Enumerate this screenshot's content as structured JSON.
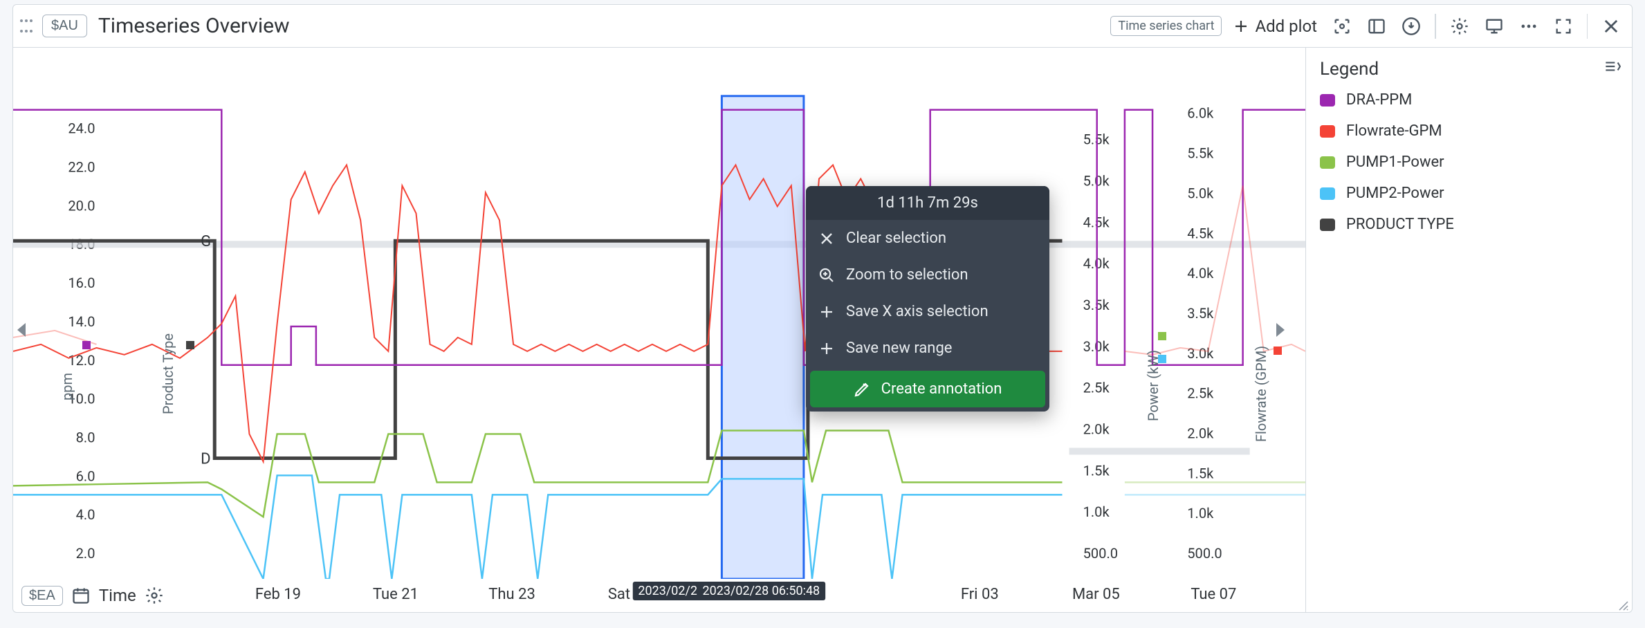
{
  "header": {
    "var_btn": "$AU",
    "title": "Timeseries Overview",
    "chart_type_chip": "Time series chart",
    "add_plot_label": "Add plot"
  },
  "legend": {
    "title": "Legend",
    "items": [
      {
        "label": "DRA-PPM",
        "color": "#9c27b0"
      },
      {
        "label": "Flowrate-GPM",
        "color": "#f44336"
      },
      {
        "label": "PUMP1-Power",
        "color": "#8bc34a"
      },
      {
        "label": "PUMP2-Power",
        "color": "#4cc3f7"
      },
      {
        "label": "PRODUCT TYPE",
        "color": "#424242"
      }
    ]
  },
  "x_axis": {
    "var_btn": "$EA",
    "time_label": "Time",
    "ticks": [
      "Feb 19",
      "Tue 21",
      "Thu 23",
      "Sat 25",
      "Fri 03",
      "Mar 05",
      "Tue 07"
    ],
    "tick_positions_pct": [
      20.5,
      29.6,
      38.6,
      47.7,
      74.8,
      83.8,
      92.9
    ],
    "selection_start_label": "2023/02/26 19",
    "selection_end_label": "2023/02/28 06:50:48"
  },
  "popover": {
    "duration": "1d 11h 7m 29s",
    "items": {
      "clear": "Clear selection",
      "zoom": "Zoom to selection",
      "save_x": "Save X axis selection",
      "save_range": "Save new range",
      "create_annotation": "Create annotation"
    }
  },
  "y_axes": {
    "left_primary": {
      "title": "ppm",
      "ticks": [
        "2.0",
        "4.0",
        "6.0",
        "8.0",
        "10.0",
        "12.0",
        "14.0",
        "16.0",
        "18.0",
        "20.0",
        "22.0",
        "24.0"
      ]
    },
    "left_secondary": {
      "title": "Product Type",
      "cat_labels": {
        "G": "G",
        "D": "D"
      }
    },
    "right_1": {
      "title": "Power (kW)",
      "ticks": [
        "500.0",
        "1.0k",
        "1.5k",
        "2.0k",
        "2.5k",
        "3.0k",
        "3.5k",
        "4.0k",
        "4.5k",
        "5.0k",
        "5.5k"
      ]
    },
    "right_2": {
      "title": "Flowrate (GPM)",
      "ticks": [
        "500.0",
        "1.0k",
        "1.5k",
        "2.0k",
        "2.5k",
        "3.0k",
        "3.5k",
        "4.0k",
        "4.5k",
        "5.0k",
        "5.5k",
        "6.0k"
      ]
    }
  },
  "chart_data": {
    "type": "line",
    "x_range": [
      "2023-02-16",
      "2023-03-08"
    ],
    "selection": {
      "start": "2023-02-26T19:00:00",
      "end": "2023-02-28T06:50:48"
    },
    "series": [
      {
        "name": "DRA-PPM",
        "axis": "ppm",
        "color": "#9c27b0",
        "segments": [
          {
            "x": [
              "2023-02-16",
              "2023-02-19T06"
            ],
            "y": 25.0
          },
          {
            "x": [
              "2023-02-19T06",
              "2023-02-20T10"
            ],
            "y": 12.0
          },
          {
            "x": [
              "2023-02-20T10",
              "2023-02-21T12"
            ],
            "y": 14.0
          },
          {
            "x": [
              "2023-02-21T12",
              "2023-02-26T19"
            ],
            "y": 12.0
          },
          {
            "x": [
              "2023-02-26T19",
              "2023-02-28T07"
            ],
            "y": 25.0
          },
          {
            "x": [
              "2023-02-28T07",
              "2023-03-01T12"
            ],
            "y": 12.0
          },
          {
            "x": [
              "2023-03-01T12",
              "2023-03-03T06"
            ],
            "y": 25.0
          },
          {
            "x": [
              "2023-03-03T06",
              "2023-03-04T08"
            ],
            "y": 12.0
          },
          {
            "x": [
              "2023-03-04T08",
              "2023-03-04T18"
            ],
            "y": 25.0
          },
          {
            "x": [
              "2023-03-04T18",
              "2023-03-06T00"
            ],
            "y": 12.0
          },
          {
            "x": [
              "2023-03-06T00",
              "2023-03-08"
            ],
            "y": 25.0
          }
        ]
      },
      {
        "name": "Flowrate-GPM",
        "axis": "Flowrate (GPM)",
        "color": "#f44336",
        "approx_points": [
          {
            "x": "2023-02-16",
            "y": 3000
          },
          {
            "x": "2023-02-19",
            "y": 3000
          },
          {
            "x": "2023-02-19T12",
            "y": 3200
          },
          {
            "x": "2023-02-20",
            "y": 2100
          },
          {
            "x": "2023-02-20T12",
            "y": 4800
          },
          {
            "x": "2023-02-21",
            "y": 4600
          },
          {
            "x": "2023-02-21T18",
            "y": 3300
          },
          {
            "x": "2023-02-22T06",
            "y": 4900
          },
          {
            "x": "2023-02-23",
            "y": 3100
          },
          {
            "x": "2023-02-23T12",
            "y": 4900
          },
          {
            "x": "2023-02-24",
            "y": 3100
          },
          {
            "x": "2023-02-26",
            "y": 3100
          },
          {
            "x": "2023-02-26T18",
            "y": 4900
          },
          {
            "x": "2023-02-28",
            "y": 5000
          },
          {
            "x": "2023-02-28T08",
            "y": 3000
          },
          {
            "x": "2023-02-28T18",
            "y": 5200
          },
          {
            "x": "2023-03-01T06",
            "y": 4900
          },
          {
            "x": "2023-03-02",
            "y": 3000
          },
          {
            "x": "2023-03-03",
            "y": 3000
          },
          {
            "x": "2023-03-04",
            "y": 3000
          },
          {
            "x": "2023-03-05",
            "y": 3000
          },
          {
            "x": "2023-03-06",
            "y": 3000
          },
          {
            "x": "2023-03-06T18",
            "y": 4900
          },
          {
            "x": "2023-03-08",
            "y": 3000
          }
        ]
      },
      {
        "name": "PUMP1-Power",
        "axis": "Power (kW)",
        "color": "#8bc34a",
        "approx_points": [
          {
            "x": "2023-02-16",
            "y": 1400
          },
          {
            "x": "2023-02-19",
            "y": 1400
          },
          {
            "x": "2023-02-20",
            "y": 1200
          },
          {
            "x": "2023-02-20T12",
            "y": 1900
          },
          {
            "x": "2023-02-21",
            "y": 1400
          },
          {
            "x": "2023-02-22",
            "y": 1900
          },
          {
            "x": "2023-02-23",
            "y": 1400
          },
          {
            "x": "2023-02-23T12",
            "y": 1900
          },
          {
            "x": "2023-02-24",
            "y": 1400
          },
          {
            "x": "2023-02-26",
            "y": 1400
          },
          {
            "x": "2023-02-26T18",
            "y": 2000
          },
          {
            "x": "2023-02-28",
            "y": 2000
          },
          {
            "x": "2023-02-28T08",
            "y": 1400
          },
          {
            "x": "2023-02-28T18",
            "y": 2000
          },
          {
            "x": "2023-03-01T06",
            "y": 2000
          },
          {
            "x": "2023-03-02",
            "y": 1400
          },
          {
            "x": "2023-03-08",
            "y": 1400
          }
        ]
      },
      {
        "name": "PUMP2-Power",
        "axis": "Power (kW)",
        "color": "#4cc3f7",
        "approx_points": [
          {
            "x": "2023-02-16",
            "y": 1300
          },
          {
            "x": "2023-02-19",
            "y": 1300
          },
          {
            "x": "2023-02-20",
            "y": 100
          },
          {
            "x": "2023-02-20T12",
            "y": 1450
          },
          {
            "x": "2023-02-21T12",
            "y": 1250
          },
          {
            "x": "2023-02-22",
            "y": 100
          },
          {
            "x": "2023-02-22T06",
            "y": 1250
          },
          {
            "x": "2023-02-23",
            "y": 100
          },
          {
            "x": "2023-02-23T06",
            "y": 1250
          },
          {
            "x": "2023-02-24",
            "y": 100
          },
          {
            "x": "2023-02-24T06",
            "y": 1250
          },
          {
            "x": "2023-02-26",
            "y": 1250
          },
          {
            "x": "2023-02-26T18",
            "y": 1400
          },
          {
            "x": "2023-02-28",
            "y": 1400
          },
          {
            "x": "2023-02-28T08",
            "y": 100
          },
          {
            "x": "2023-02-28T14",
            "y": 1250
          },
          {
            "x": "2023-03-01",
            "y": 100
          },
          {
            "x": "2023-03-01T06",
            "y": 1300
          },
          {
            "x": "2023-03-02",
            "y": 100
          },
          {
            "x": "2023-03-02T06",
            "y": 1250
          },
          {
            "x": "2023-03-08",
            "y": 1250
          }
        ]
      },
      {
        "name": "PRODUCT TYPE",
        "axis": "Product Type",
        "color": "#424242",
        "segments": [
          {
            "x": [
              "2023-02-16",
              "2023-02-19T06"
            ],
            "y": "G"
          },
          {
            "x": [
              "2023-02-19T06",
              "2023-02-21T12"
            ],
            "y": "D"
          },
          {
            "x": [
              "2023-02-21T12",
              "2023-02-26T19"
            ],
            "y": "G"
          },
          {
            "x": [
              "2023-02-26T19",
              "2023-02-28T07"
            ],
            "y": "D"
          },
          {
            "x": [
              "2023-02-28T07",
              "2023-03-01T12"
            ],
            "y": "G"
          },
          {
            "x": [
              "2023-03-01T12",
              "2023-03-08"
            ],
            "y": "G"
          }
        ]
      }
    ]
  }
}
